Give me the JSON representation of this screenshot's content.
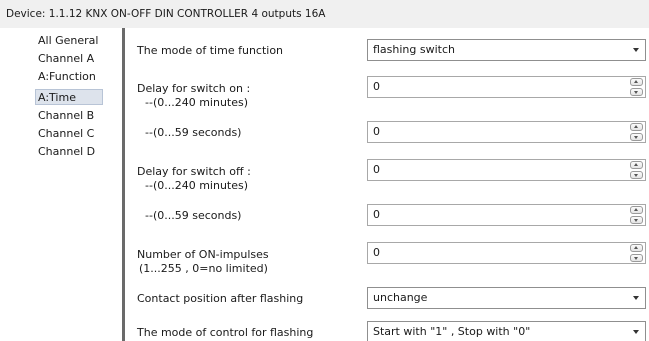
{
  "header": {
    "device_title": "Device: 1.1.12  KNX ON-OFF DIN CONTROLLER 4 outputs 16A"
  },
  "sidebar": {
    "items": [
      {
        "label": "All General"
      },
      {
        "label": "Channel A"
      },
      {
        "label": "A:Function"
      },
      {
        "label": "A:Time"
      },
      {
        "label": "Channel B"
      },
      {
        "label": "Channel C"
      },
      {
        "label": "Channel D"
      }
    ],
    "selected": "A:Time"
  },
  "params": {
    "time_mode": {
      "label": "The mode of time function",
      "value": "flashing switch"
    },
    "delay_on_minutes": {
      "label_line1": "Delay for switch on :",
      "label_line2": "--(0...240 minutes)",
      "value": "0"
    },
    "delay_on_seconds": {
      "label": "--(0...59 seconds)",
      "value": "0"
    },
    "delay_off_minutes": {
      "label_line1": "Delay for switch off :",
      "label_line2": "--(0...240 minutes)",
      "value": "0"
    },
    "delay_off_seconds": {
      "label": "--(0...59 seconds)",
      "value": "0"
    },
    "on_impulses": {
      "label_line1": "Number of ON-impulses",
      "label_line2": "(1...255 , 0=no limited)",
      "value": "0"
    },
    "contact_position": {
      "label": "Contact position after flashing",
      "value": "unchange"
    },
    "control_mode": {
      "label": "The mode of control for flashing",
      "value": "Start with \"1\" , Stop with \"0\""
    }
  },
  "icons": {
    "dropdown": "chevron-down-icon",
    "spin_up": "spin-up-icon",
    "spin_down": "spin-down-icon"
  }
}
